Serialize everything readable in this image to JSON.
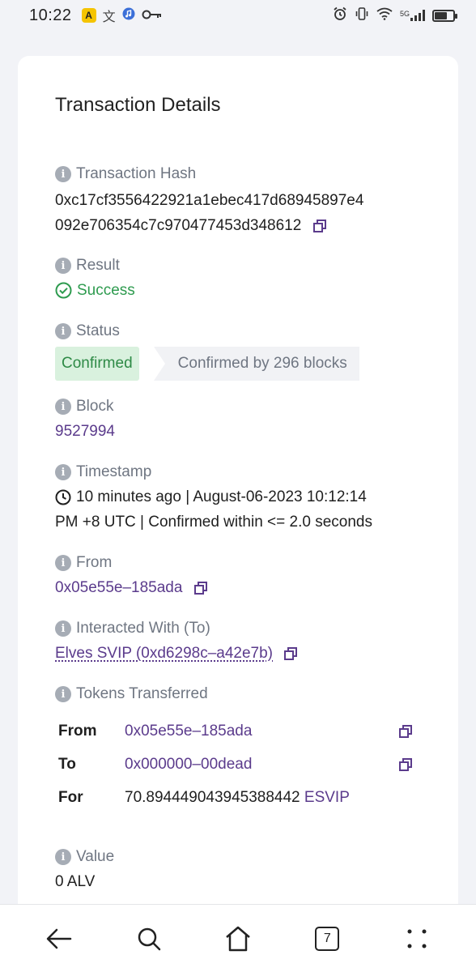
{
  "status_bar": {
    "time": "10:22",
    "network": "5G",
    "left_icons": [
      "app-a-icon",
      "translate-icon",
      "music-icon",
      "key-icon"
    ],
    "right_icons": [
      "alarm-icon",
      "vibrate-icon",
      "wifi-icon",
      "signal-icon",
      "battery-icon"
    ]
  },
  "page": {
    "title": "Transaction Details"
  },
  "transaction_hash": {
    "label": "Transaction Hash",
    "value_line1": "0xc17cf3556422921a1ebec417d68945897e4",
    "value_line2": "092e706354c7c970477453d348612"
  },
  "result": {
    "label": "Result",
    "value": "Success"
  },
  "status": {
    "label": "Status",
    "badge": "Confirmed",
    "confirmations": "Confirmed by 296 blocks"
  },
  "block": {
    "label": "Block",
    "value": "9527994"
  },
  "timestamp": {
    "label": "Timestamp",
    "line1": "10 minutes ago | August-06-2023 10:12:14",
    "line2": "PM +8 UTC | Confirmed within <= 2.0 seconds"
  },
  "from": {
    "label": "From",
    "value": "0x05e55e–185ada"
  },
  "interacted_with": {
    "label": "Interacted With (To)",
    "value": "Elves SVIP (0xd6298c–a42e7b)"
  },
  "tokens_transferred": {
    "label": "Tokens Transferred",
    "rows": [
      {
        "key": "From",
        "value": "0x05e55e–185ada"
      },
      {
        "key": "To",
        "value": "0x000000–00dead"
      },
      {
        "key": "For",
        "amount": "70.894449043945388442",
        "token": "ESVIP"
      }
    ]
  },
  "value_field": {
    "label": "Value",
    "value": "0 ALV"
  },
  "navbar": {
    "tab_count": "7"
  },
  "colors": {
    "accent_link": "#5b3b8c",
    "success": "#2e9b4f",
    "confirmed_bg": "#d9f1de",
    "page_bg": "#f2f3f7"
  }
}
